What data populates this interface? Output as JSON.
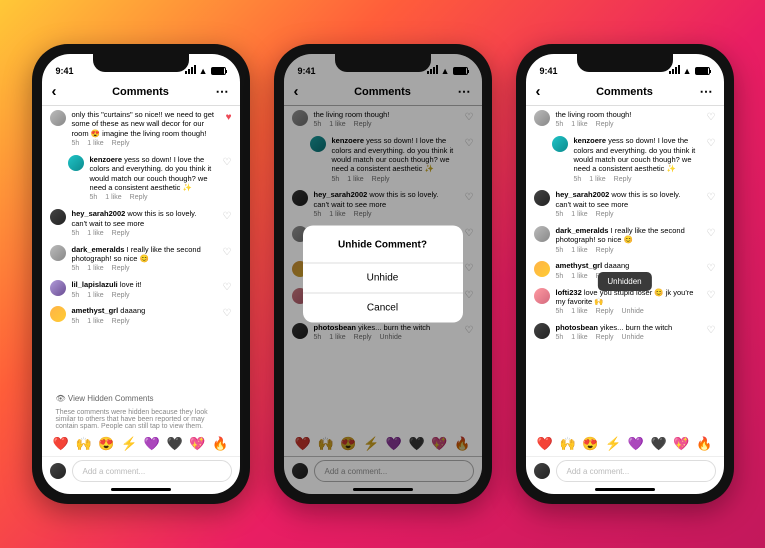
{
  "status": {
    "time": "9:41"
  },
  "header": {
    "title": "Comments"
  },
  "composer": {
    "placeholder": "Add a comment..."
  },
  "emojis": [
    "❤️",
    "🙌",
    "😍",
    "⚡",
    "💜",
    "🖤",
    "💖",
    "🔥"
  ],
  "dialog": {
    "title": "Unhide Comment?",
    "unhide": "Unhide",
    "cancel": "Cancel"
  },
  "toast": "Unhidden",
  "hidden_block": {
    "link": "View Hidden Comments",
    "note": "These comments were hidden because they look similar to others that have been reported or may contain spam. People can still tap to view them."
  },
  "meta": {
    "time": "5h",
    "likes": "1 like",
    "reply": "Reply",
    "unhide": "Unhide"
  },
  "phone1": [
    {
      "user": "",
      "text": " only this \"curtains\" so nice!! we need to get some of these as new wall decor for our room 😍 imagine the living room though!",
      "avatar": "av-grey",
      "liked": true,
      "cut": true
    },
    {
      "user": "kenzoere",
      "text": " yess so down! I love the colors and everything. do you think it would match our couch though? we need a consistent aesthetic ✨",
      "avatar": "av-teal",
      "indent": true
    },
    {
      "user": "hey_sarah2002",
      "text": " wow this is so lovely. can't wait to see more",
      "avatar": "av-dark"
    },
    {
      "user": "dark_emeralds",
      "text": " I really like the second photograph! so nice 😊",
      "avatar": "av-grey"
    },
    {
      "user": "lil_lapislazuli",
      "text": " love it!",
      "avatar": "av-purple"
    },
    {
      "user": "amethyst_grl",
      "text": " daaang",
      "avatar": "av-sun"
    }
  ],
  "phone2": [
    {
      "user": "",
      "text": " the living room though!",
      "avatar": "av-grey",
      "cut": true
    },
    {
      "user": "kenzoere",
      "text": " yess so down! I love the colors and everything. do you think it would match our couch though? we need a consistent aesthetic ✨",
      "avatar": "av-teal",
      "indent": true
    },
    {
      "user": "hey_sarah2002",
      "text": " wow this is so lovely. can't wait to see more",
      "avatar": "av-dark"
    },
    {
      "user": "dark_emeralds",
      "text": " I really like the second photograph! so nice 😊",
      "avatar": "av-grey"
    },
    {
      "user": "amethyst_grl",
      "text": " daaang",
      "avatar": "av-sun"
    },
    {
      "user": "lofti232",
      "text": " love you stupid loser 😊 jk you're my favorite 🙌",
      "avatar": "av-pink",
      "unhide": true
    },
    {
      "user": "photosbean",
      "text": " yikes... burn the witch",
      "avatar": "av-dark",
      "unhide": true
    }
  ],
  "phone3": [
    {
      "user": "",
      "text": " the living room though!",
      "avatar": "av-grey",
      "cut": true
    },
    {
      "user": "kenzoere",
      "text": " yess so down! I love the colors and everything. do you think it would match our couch though? we need a consistent aesthetic ✨",
      "avatar": "av-teal",
      "indent": true
    },
    {
      "user": "hey_sarah2002",
      "text": " wow this is so lovely. can't wait to see more",
      "avatar": "av-dark"
    },
    {
      "user": "dark_emeralds",
      "text": " I really like the second photograph! so nice 😊",
      "avatar": "av-grey"
    },
    {
      "user": "amethyst_grl",
      "text": " daaang",
      "avatar": "av-sun"
    },
    {
      "user": "lofti232",
      "text": " love you stupid loser 😊 jk you're my favorite 🙌",
      "avatar": "av-pink",
      "unhide": true
    },
    {
      "user": "photosbean",
      "text": " yikes... burn the witch",
      "avatar": "av-dark",
      "unhide": true
    }
  ]
}
